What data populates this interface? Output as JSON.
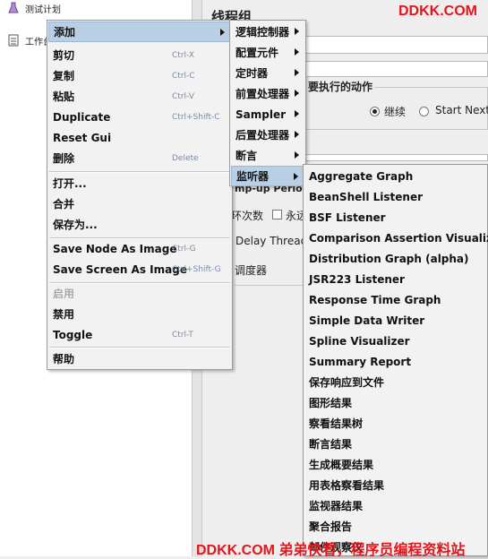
{
  "tree": {
    "items": [
      {
        "label": "测试计划"
      },
      {
        "label": "工作台"
      }
    ]
  },
  "background": {
    "panel_title": "线程组",
    "group_title": "要执行的动作",
    "radio_continue": "继续",
    "radio_start_next": "Start Next",
    "rampup_label": "mp-up Period",
    "loop_label": "环次数",
    "forever_label": "永远",
    "delay_label": "Delay Thread",
    "scheduler_label": "调度器"
  },
  "context_menu": {
    "items": [
      {
        "label": "添加",
        "shortcut": "",
        "submenu": true
      },
      {
        "label": "剪切",
        "shortcut": "Ctrl-X"
      },
      {
        "label": "复制",
        "shortcut": "Ctrl-C"
      },
      {
        "label": "粘贴",
        "shortcut": "Ctrl-V"
      },
      {
        "label": "Duplicate",
        "shortcut": "Ctrl+Shift-C"
      },
      {
        "label": "Reset Gui",
        "shortcut": ""
      },
      {
        "label": "删除",
        "shortcut": "Delete"
      },
      {
        "label": "打开...",
        "shortcut": ""
      },
      {
        "label": "合并",
        "shortcut": ""
      },
      {
        "label": "保存为...",
        "shortcut": ""
      },
      {
        "label": "Save Node As Image",
        "shortcut": "Ctrl-G"
      },
      {
        "label": "Save Screen As Image",
        "shortcut": "Ctrl+Shift-G"
      },
      {
        "label": "启用",
        "shortcut": ""
      },
      {
        "label": "禁用",
        "shortcut": ""
      },
      {
        "label": "Toggle",
        "shortcut": "Ctrl-T"
      },
      {
        "label": "帮助",
        "shortcut": ""
      }
    ]
  },
  "add_submenu": {
    "items": [
      {
        "label": "逻辑控制器"
      },
      {
        "label": "配置元件"
      },
      {
        "label": "定时器"
      },
      {
        "label": "前置处理器"
      },
      {
        "label": "Sampler"
      },
      {
        "label": "后置处理器"
      },
      {
        "label": "断言"
      },
      {
        "label": "监听器"
      }
    ]
  },
  "listener_submenu": {
    "items": [
      {
        "label": "Aggregate Graph"
      },
      {
        "label": "BeanShell Listener"
      },
      {
        "label": "BSF Listener"
      },
      {
        "label": "Comparison Assertion Visualizer"
      },
      {
        "label": "Distribution Graph (alpha)"
      },
      {
        "label": "JSR223 Listener"
      },
      {
        "label": "Response Time Graph"
      },
      {
        "label": "Simple Data Writer"
      },
      {
        "label": "Spline Visualizer"
      },
      {
        "label": "Summary Report"
      },
      {
        "label": "保存响应到文件"
      },
      {
        "label": "图形结果"
      },
      {
        "label": "察看结果树"
      },
      {
        "label": "断言结果"
      },
      {
        "label": "生成概要结果"
      },
      {
        "label": "用表格察看结果"
      },
      {
        "label": "监视器结果"
      },
      {
        "label": "聚合报告"
      },
      {
        "label": "邮件观察仪"
      }
    ]
  },
  "watermark": {
    "top": "DDKK.COM",
    "bottom": "DDKK.COM 弟弟快看，程序员编程资料站"
  },
  "colors": {
    "highlight": "#b8cfe5",
    "watermark": "#e4141b",
    "shortcut": "#7b8aa8"
  }
}
